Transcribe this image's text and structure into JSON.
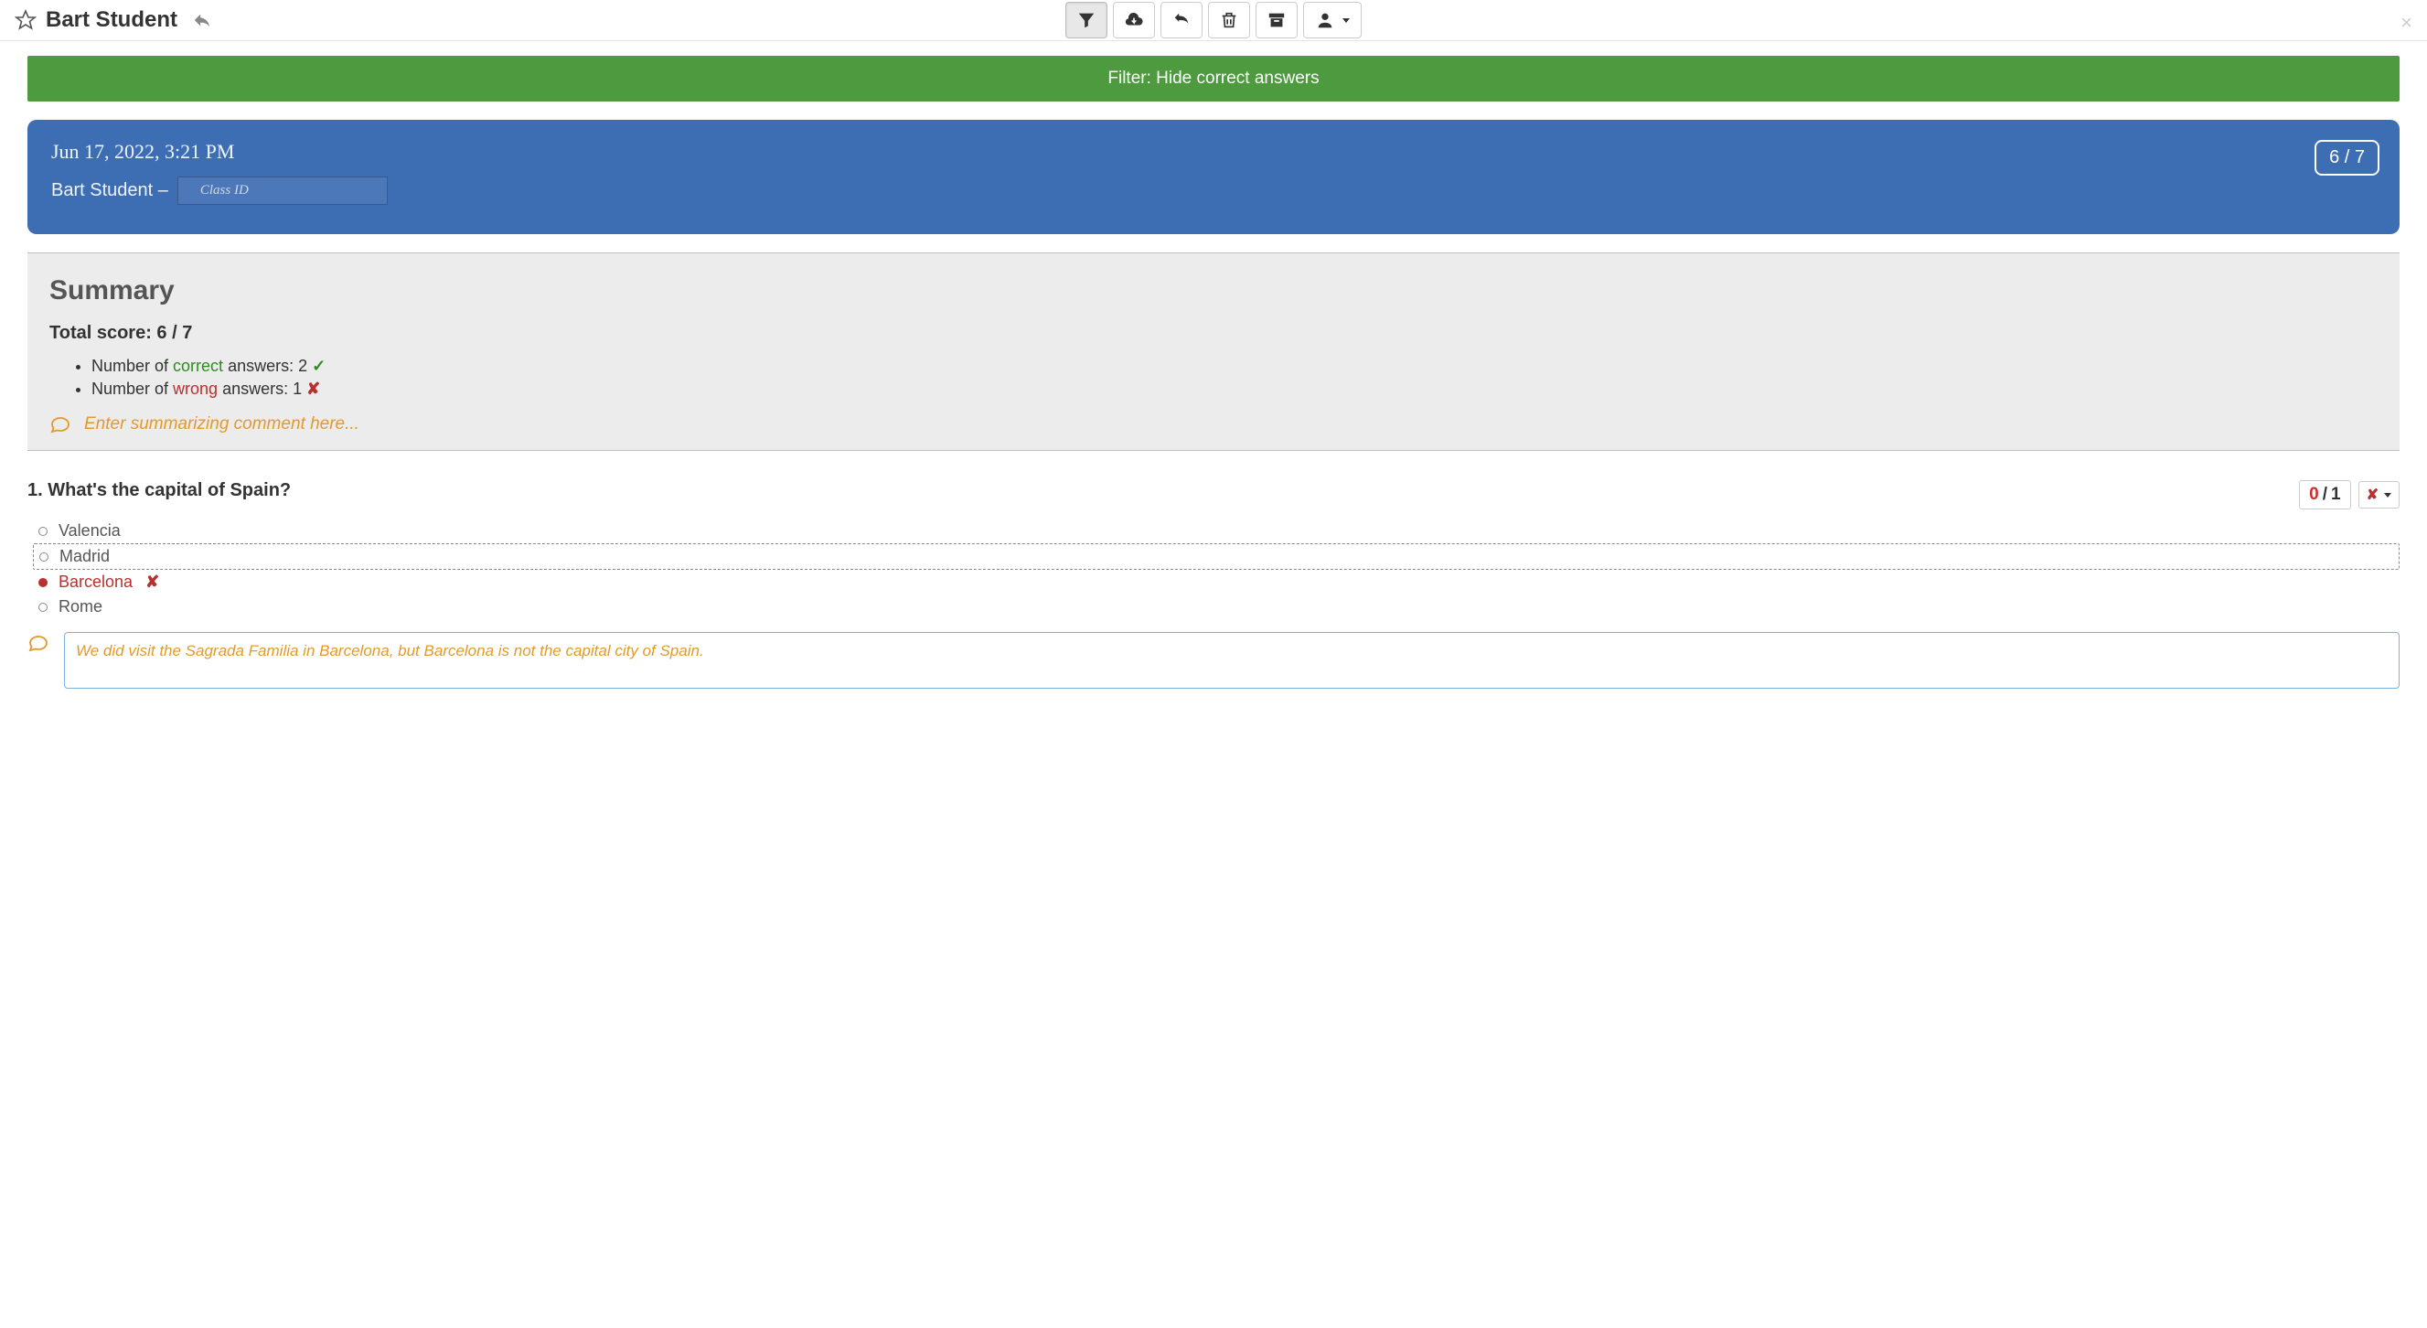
{
  "header": {
    "student_name": "Bart Student"
  },
  "filter_banner": "Filter: Hide correct answers",
  "info": {
    "date": "Jun 17, 2022, 3:21 PM",
    "name_line": "Bart Student –",
    "class_id_placeholder": "Class ID",
    "score": "6 / 7"
  },
  "summary": {
    "title": "Summary",
    "total_label": "Total score: 6 / 7",
    "correct_prefix": "Number of ",
    "correct_word": "correct",
    "correct_suffix": " answers: 2 ",
    "wrong_prefix": "Number of ",
    "wrong_word": "wrong",
    "wrong_suffix": " answers: 1 ",
    "comment_placeholder": "Enter summarizing comment here..."
  },
  "question": {
    "text": "1. What's the capital of Spain?",
    "score_got": "0",
    "score_sep": "/",
    "score_max": "1",
    "options": [
      {
        "label": "Valencia",
        "correct": false,
        "selected": false
      },
      {
        "label": "Madrid",
        "correct": true,
        "selected": false
      },
      {
        "label": "Barcelona",
        "correct": false,
        "selected": true
      },
      {
        "label": "Rome",
        "correct": false,
        "selected": false
      }
    ],
    "comment_value": "We did visit the Sagrada Familia in Barcelona, but Barcelona is not the capital city of Spain."
  }
}
